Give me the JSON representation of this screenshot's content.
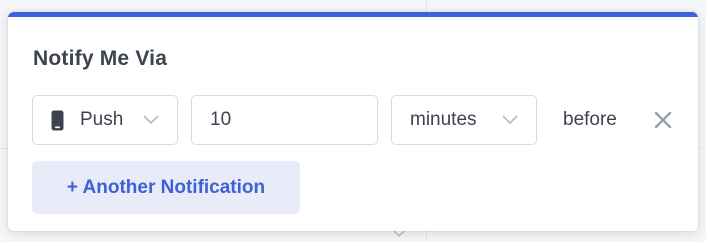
{
  "notify": {
    "title": "Notify Me Via",
    "method": {
      "label": "Push",
      "icon": "mobile-phone-icon"
    },
    "amount": {
      "value": "10"
    },
    "unit": {
      "label": "minutes"
    },
    "suffix": "before",
    "remove_icon": "close-icon",
    "add_button_label": "+ Another Notification"
  },
  "colors": {
    "accent": "#4160dc",
    "add_button_bg": "#e8ecf9",
    "add_button_text": "#3f60d6",
    "text": "#3d4350",
    "border": "#d7dbe2"
  }
}
